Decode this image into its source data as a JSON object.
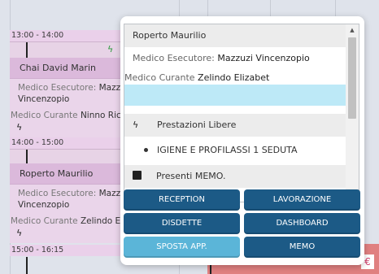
{
  "calendar": {
    "slots": [
      {
        "time": "13:00 - 14:00"
      },
      {
        "time": "14:00 - 15:00"
      },
      {
        "time": "15:00 - 16:15"
      }
    ],
    "appointments": [
      {
        "patient": "Chai David Marin",
        "executor_label": "Medico Esecutore:",
        "executor_value": "Mazzuzi",
        "executor_value_cont": "Vincenzopio",
        "attending_label": "Medico Curante",
        "attending_value": "Ninno Ricca"
      },
      {
        "patient": "Roperto Maurilio",
        "executor_label": "Medico Esecutore:",
        "executor_value": "Mazzu",
        "executor_value_cont": "Vincenzopio",
        "attending_label": "Medico Curante",
        "attending_value": "Zelindo Elizab"
      }
    ],
    "euro_symbol": "€"
  },
  "popup": {
    "patient": "Roperto Maurilio",
    "executor_label": "Medico Esecutore:",
    "executor_value": "Mazzuzi Vincenzopio",
    "attending_label": "Medico Curante",
    "attending_value": "Zelindo Elizabet",
    "prestazioni_label": "Prestazioni Libere",
    "prestazioni_item": "IGIENE E PROFILASSI 1 SEDUTA",
    "memo_label": "Presenti MEMO.",
    "buttons": {
      "reception": "RECEPTION",
      "lavorazione": "LAVORAZIONE",
      "disdette": "DISDETTE",
      "dashboard": "DASHBOARD",
      "sposta": "SPOSTA APP.",
      "memo": "MEMO"
    }
  },
  "icons": {
    "bolt": "lightning-bolt",
    "memo": "memo-note",
    "scroll_up": "triangle-up",
    "scroll_down": "triangle-down"
  },
  "colors": {
    "button_dark": "#1c5a86",
    "button_light": "#5bb5d8",
    "highlight_row": "#bde9f7",
    "appointment_bg": "#ead5ea"
  }
}
